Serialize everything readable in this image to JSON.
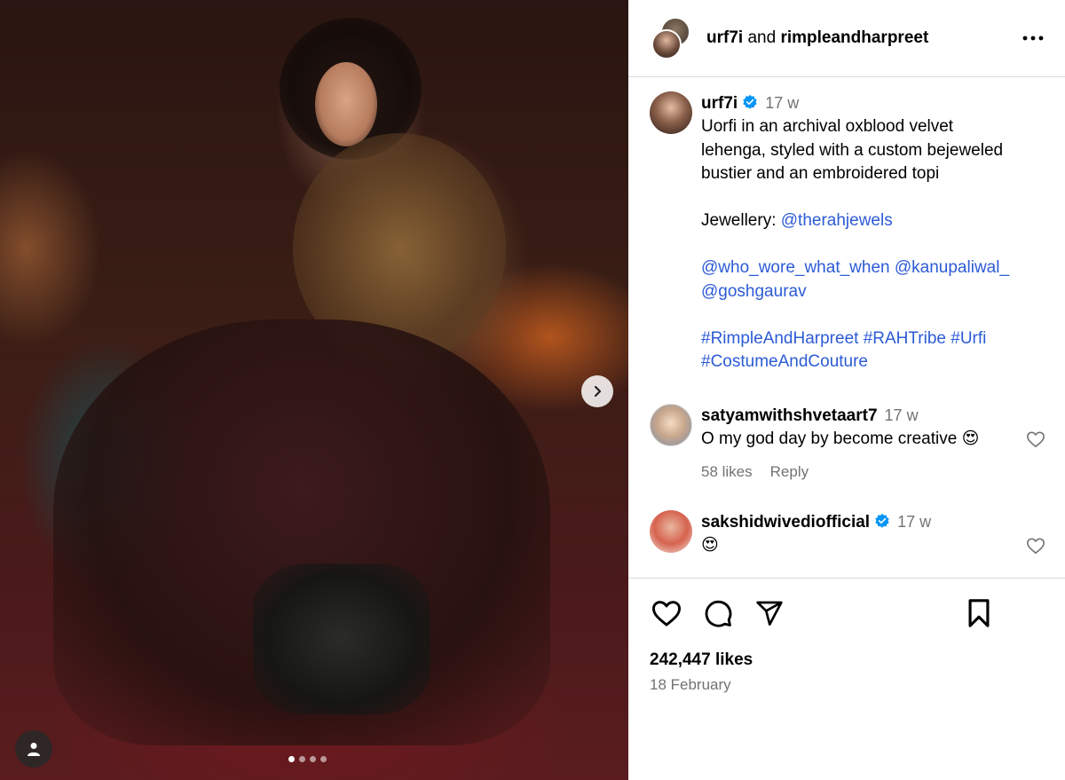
{
  "media": {
    "image_alt": "Uorfi in an archival oxblood velvet lehenga",
    "carousel_dots": 4,
    "active_dot": 1
  },
  "header": {
    "user1": "urf7i",
    "joiner": "and",
    "user2": "rimpleandharpreet"
  },
  "caption": {
    "username": "urf7i",
    "time": "17 w",
    "text_line": "Uorfi in an archival oxblood velvet lehenga, styled with a custom bejeweled bustier and an embroidered topi",
    "jewellery_label": "Jewellery: ",
    "jewellery_tag": "@therahjewels",
    "tag_1": "@who_wore_what_when",
    "tag_2": "@kanupaliwal_",
    "tag_3": "@goshgaurav",
    "hashtag_1": "#RimpleAndHarpreet",
    "hashtag_2": "#RAHTribe",
    "hashtag_3": "#Urfi",
    "hashtag_4": "#CostumeAndCouture"
  },
  "comments": [
    {
      "username": "satyamwithshvetaart7",
      "time": "17 w",
      "text": "O my god day by become creative",
      "emoji": "😍",
      "likes": "58 likes",
      "reply": "Reply"
    },
    {
      "username": "sakshidwivediofficial",
      "time": "17 w",
      "emoji": "😍"
    }
  ],
  "footer": {
    "likes": "242,447 likes",
    "date": "18 February"
  },
  "colors": {
    "link": "#2c5bd6",
    "muted": "#737373",
    "verified": "#0095f6",
    "divider": "#dbdbdb"
  }
}
